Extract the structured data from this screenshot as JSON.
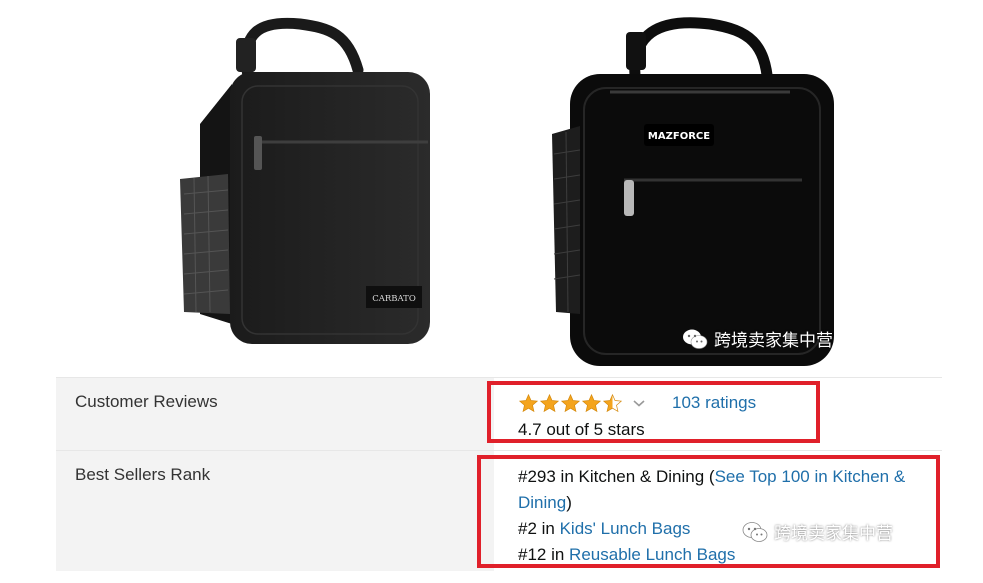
{
  "products": {
    "left_brand": "CARBATO",
    "right_brand": "MAZFORCE"
  },
  "watermark_text": "跨境卖家集中营",
  "details": {
    "reviews_label": "Customer Reviews",
    "rating_stars": 4.7,
    "ratings_link": "103 ratings",
    "rating_summary": "4.7 out of 5 stars",
    "rank_label": "Best Sellers Rank",
    "rank": {
      "r1_prefix": "#293 in Kitchen & Dining (",
      "r1_link_a": "See Top 100 in Kitchen &",
      "r1_link_b": "Dining",
      "r1_suffix": ")",
      "r2_prefix": "#2 in ",
      "r2_link": "Kids' Lunch Bags",
      "r3_prefix": "#12 in ",
      "r3_link": "Reusable Lunch Bags"
    }
  },
  "colors": {
    "link": "#1f6faa",
    "highlight": "#e0202a",
    "star": "#f4a41d"
  }
}
